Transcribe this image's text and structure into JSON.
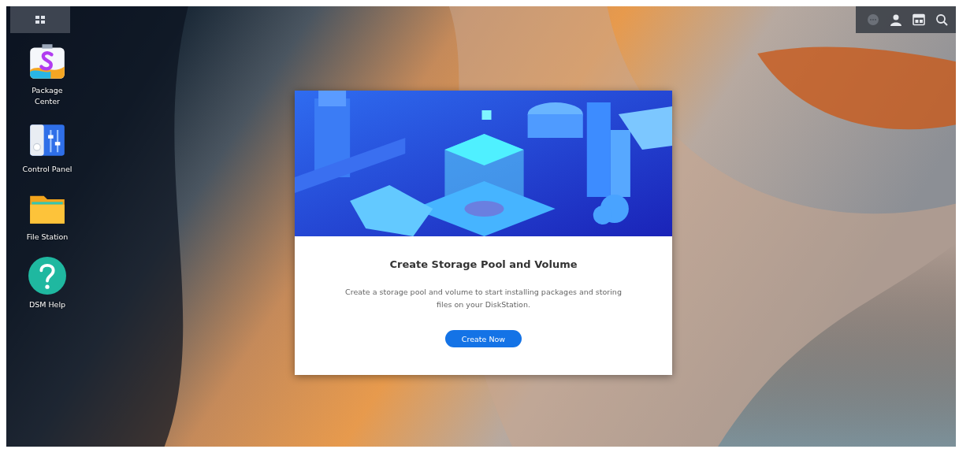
{
  "desktop": {
    "shortcuts": [
      {
        "kind": "package",
        "label": "Package\nCenter"
      },
      {
        "kind": "control",
        "label": "Control Panel"
      },
      {
        "kind": "folder",
        "label": "File Station"
      },
      {
        "kind": "help",
        "label": "DSM Help"
      }
    ]
  },
  "dialog": {
    "title": "Create Storage Pool and Volume",
    "message": "Create a storage pool and volume to start installing packages and storing files on your DiskStation.",
    "button": "Create Now"
  }
}
